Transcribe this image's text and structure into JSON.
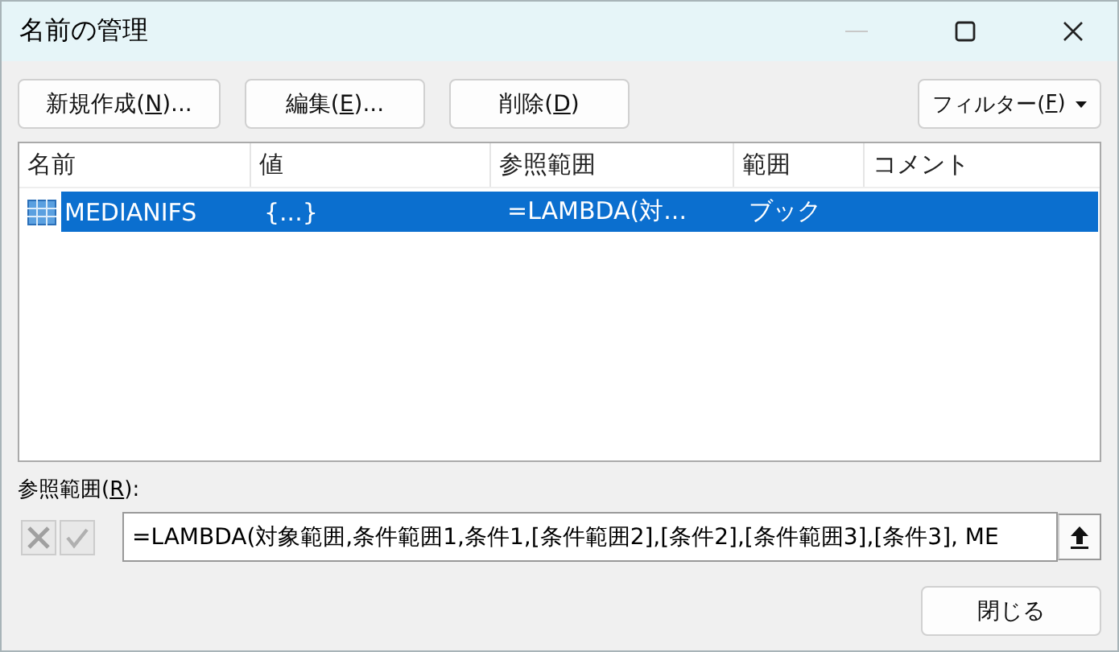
{
  "window": {
    "title": "名前の管理"
  },
  "buttons": [
    {
      "before": "新規作成(",
      "key": "N",
      "after": ")..."
    },
    {
      "before": "編集(",
      "key": "E",
      "after": ")..."
    },
    {
      "before": "削除(",
      "key": "D",
      "after": ")"
    }
  ],
  "filter": {
    "before": "フィルター(",
    "key": "F",
    "after": ")"
  },
  "table": {
    "columns": [
      "名前",
      "値",
      "参照範囲",
      "範囲",
      "コメント"
    ],
    "rows": [
      {
        "selected": true,
        "cells": [
          "MEDIANIFS",
          "{...}",
          "=LAMBDA(対...",
          "ブック",
          ""
        ]
      }
    ]
  },
  "refers_to": {
    "before": "参照範囲(",
    "key": "R",
    "after": "):",
    "value": "=LAMBDA(対象範囲,条件範囲1,条件1,[条件範囲2],[条件2],[条件範囲3],[条件3], ME"
  },
  "close_button": "閉じる"
}
